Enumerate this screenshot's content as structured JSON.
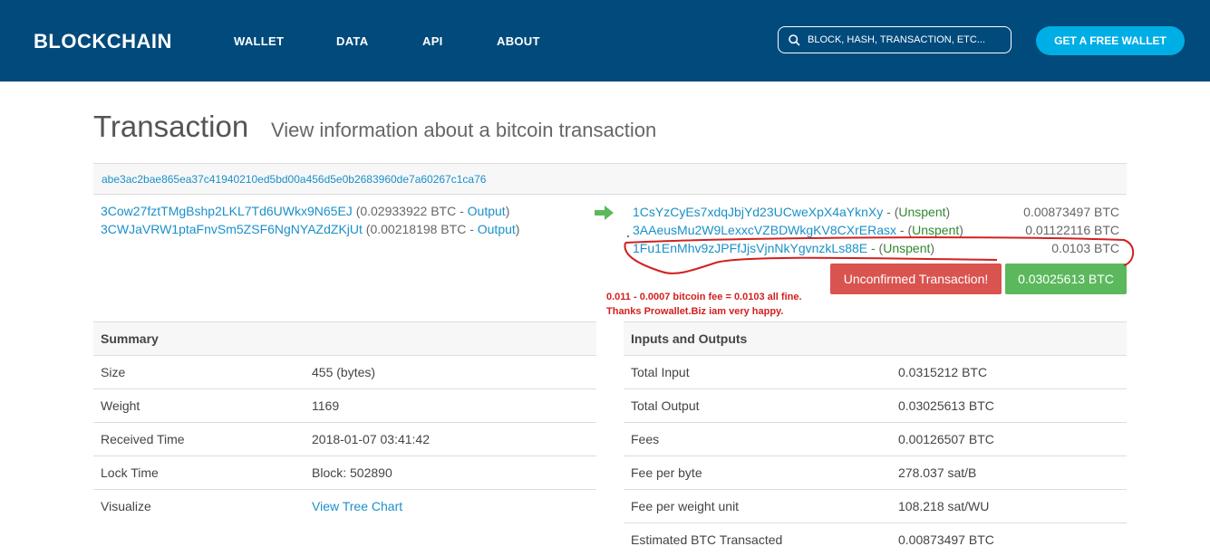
{
  "nav": {
    "logo": "BLOCKCHAIN",
    "links": [
      "WALLET",
      "DATA",
      "API",
      "ABOUT"
    ],
    "search_placeholder": "BLOCK, HASH, TRANSACTION, ETC...",
    "cta": "GET A FREE WALLET"
  },
  "colors": {
    "nav_bg": "#004a7c",
    "accent": "#00aee6",
    "link": "#1a90c8",
    "danger": "#d9534f",
    "success": "#5cb85c",
    "annotation": "#d32020"
  },
  "page": {
    "title": "Transaction",
    "subtitle": "View information about a bitcoin transaction"
  },
  "tx": {
    "hash": "abe3ac2bae865ea37c41940210ed5bd00a456d5e0b2683960de7a60267c1ca76",
    "inputs": [
      {
        "address": "3Cow27fztTMgBshp2LKL7Td6UWkx9N65EJ",
        "amount": "(0.02933922 BTC - ",
        "link": "Output",
        "close": ")"
      },
      {
        "address": "3CWJaVRW1ptaFnvSm5ZSF6NgNYAZdZKjUt",
        "amount": "(0.00218198 BTC - ",
        "link": "Output",
        "close": ")"
      }
    ],
    "outputs": [
      {
        "address": "1CsYzCyEs7xdqJbjYd23UCweXpX4aYknXy",
        "sep": " - (",
        "status": "Unspent",
        "close": ")",
        "amount": "0.00873497 BTC"
      },
      {
        "address": "3AAeusMu2W9LexxcVZBDWkgKV8CXrERasx",
        "sep": " - (",
        "status": "Unspent",
        "close": ")",
        "amount": "0.01122116 BTC"
      },
      {
        "address": "1Fu1EnMhv9zJPFfJjsVjnNkYgvnzkLs88E",
        "sep": " - (",
        "status": "Unspent",
        "close": ")",
        "amount": "0.0103 BTC"
      }
    ],
    "unconfirmed_label": "Unconfirmed Transaction!",
    "total": "0.03025613 BTC"
  },
  "annotation": {
    "line1": "0.011 - 0.0007 bitcoin fee = 0.0103 all fine.",
    "line2": "Thanks Prowallet.Biz iam very happy."
  },
  "summary": {
    "heading": "Summary",
    "rows": [
      {
        "label": "Size",
        "value": "455 (bytes)"
      },
      {
        "label": "Weight",
        "value": "1169"
      },
      {
        "label": "Received Time",
        "value": "2018-01-07 03:41:42"
      },
      {
        "label": "Lock Time",
        "value": "Block: 502890"
      },
      {
        "label": "Visualize",
        "value": "View Tree Chart"
      }
    ]
  },
  "io": {
    "heading": "Inputs and Outputs",
    "rows": [
      {
        "label": "Total Input",
        "value": "0.0315212 BTC"
      },
      {
        "label": "Total Output",
        "value": "0.03025613 BTC"
      },
      {
        "label": "Fees",
        "value": "0.00126507 BTC"
      },
      {
        "label": "Fee per byte",
        "value": "278.037 sat/B"
      },
      {
        "label": "Fee per weight unit",
        "value": "108.218 sat/WU"
      },
      {
        "label": "Estimated BTC Transacted",
        "value": "0.00873497 BTC"
      }
    ]
  }
}
